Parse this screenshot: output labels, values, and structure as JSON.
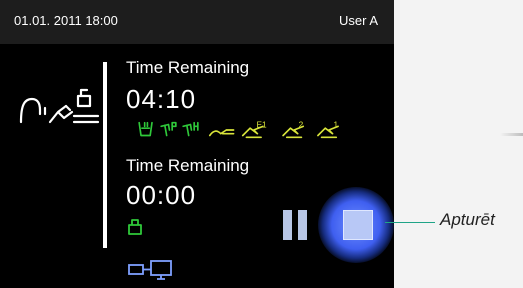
{
  "status_bar": {
    "datetime": "01.01. 2011 18:00",
    "user": "User A"
  },
  "section1": {
    "label": "Time Remaining",
    "time": "04:10"
  },
  "section2": {
    "label": "Time Remaining",
    "time": "00:00"
  },
  "symbols": {
    "s1": "E1",
    "s2": "2",
    "s3": "1",
    "yellow_color": "#d8e43a",
    "green_color": "#2fc93a"
  },
  "controls": {
    "pause": "pause-icon",
    "stop": "stop-icon"
  },
  "callout": {
    "label": "Apturēt"
  },
  "colors": {
    "accent": "#3f5ff0",
    "callout_line": "#1fa487"
  }
}
